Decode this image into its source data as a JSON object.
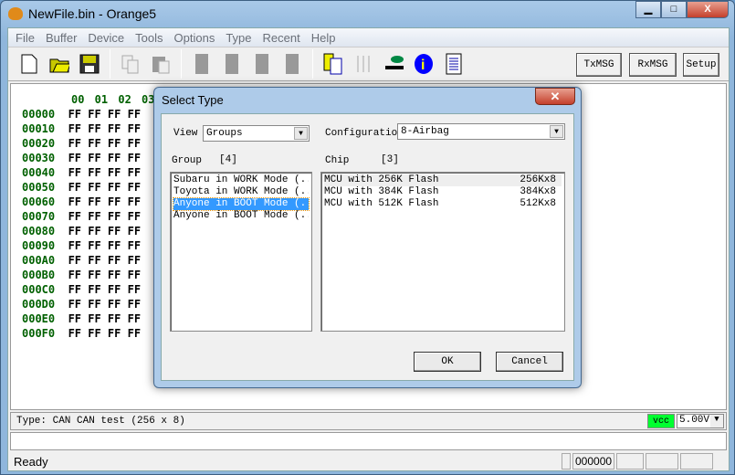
{
  "window": {
    "title": "NewFile.bin - Orange5",
    "min": "▁",
    "max": "□",
    "close": "X"
  },
  "menu": [
    "File",
    "Buffer",
    "Device",
    "Tools",
    "Options",
    "Type",
    "Recent",
    "Help"
  ],
  "toolbar": {
    "icons": [
      "new-file",
      "open-folder",
      "save-disk",
      "copy",
      "paste",
      "chip",
      "chip",
      "chip",
      "chip",
      "device-config",
      "adjust-sliders",
      "tools",
      "info",
      "notepad"
    ],
    "txmsg": "TxMSG",
    "rxmsg": "RxMSG",
    "setup": "Setup"
  },
  "hex": {
    "columns": "00 01 02 03",
    "rows": [
      {
        "addr": "00000",
        "bytes": "FF FF FF FF"
      },
      {
        "addr": "00010",
        "bytes": "FF FF FF FF"
      },
      {
        "addr": "00020",
        "bytes": "FF FF FF FF"
      },
      {
        "addr": "00030",
        "bytes": "FF FF FF FF"
      },
      {
        "addr": "00040",
        "bytes": "FF FF FF FF"
      },
      {
        "addr": "00050",
        "bytes": "FF FF FF FF"
      },
      {
        "addr": "00060",
        "bytes": "FF FF FF FF"
      },
      {
        "addr": "00070",
        "bytes": "FF FF FF FF"
      },
      {
        "addr": "00080",
        "bytes": "FF FF FF FF"
      },
      {
        "addr": "00090",
        "bytes": "FF FF FF FF"
      },
      {
        "addr": "000A0",
        "bytes": "FF FF FF FF"
      },
      {
        "addr": "000B0",
        "bytes": "FF FF FF FF"
      },
      {
        "addr": "000C0",
        "bytes": "FF FF FF FF"
      },
      {
        "addr": "000D0",
        "bytes": "FF FF FF FF"
      },
      {
        "addr": "000E0",
        "bytes": "FF FF FF FF"
      },
      {
        "addr": "000F0",
        "bytes": "FF FF FF FF"
      }
    ]
  },
  "typebar": {
    "text": "Type: CAN CAN test (256 x 8)",
    "vcc": "vcc",
    "voltage": "5.00V",
    "vcc_color": "#00ff30"
  },
  "status": {
    "text": "Ready",
    "address": "000000"
  },
  "dialog": {
    "title": "Select Type",
    "close": "✕",
    "view_label": "View",
    "view_value": "Groups",
    "config_label": "Configuratio",
    "config_value": "8-Airbag",
    "group_label": "Group",
    "group_count": "[4]",
    "chip_label": "Chip",
    "chip_count": "[3]",
    "groups": [
      "Subaru in WORK Mode (...",
      "Toyota in WORK Mode (...",
      "Anyone in BOOT Mode (...",
      "Anyone in BOOT Mode (..."
    ],
    "selected_group": 2,
    "chips": [
      {
        "name": "MCU with 256K Flash",
        "size": "256Kx8"
      },
      {
        "name": "MCU with 384K Flash",
        "size": "384Kx8"
      },
      {
        "name": "MCU with 512K Flash",
        "size": "512Kx8"
      }
    ],
    "ok": "OK",
    "cancel": "Cancel"
  }
}
